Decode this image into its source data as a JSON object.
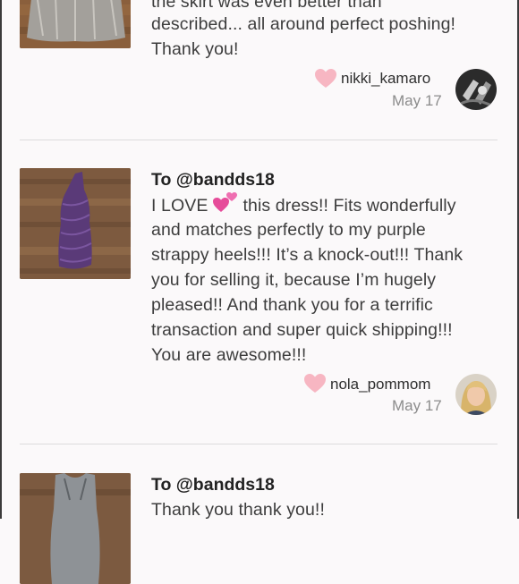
{
  "reviews": [
    {
      "to": "",
      "lines": [
        "the skirt was even better than",
        "described... all around perfect poshing!",
        "Thank you!"
      ],
      "username": "nikki_kamaro",
      "date": "May 17",
      "thumb_icon": "gray-skirt-photo",
      "avatar_icon": "nail-art-avatar"
    },
    {
      "to": "To @bandds18",
      "lines": [
        "I LOVE",
        " this dress!! Fits wonderfully",
        "and matches perfectly to my purple",
        "strappy heels!!! It’s a knock-out!!! Thank",
        "you for selling it, because I’m hugely",
        "pleased!! And thank you for a terrific",
        "transaction and super quick shipping!!!",
        "You are awesome!!!"
      ],
      "username": "nola_pommom",
      "date": "May 17",
      "thumb_icon": "purple-dress-photo",
      "avatar_icon": "blonde-woman-avatar"
    },
    {
      "to": "To @bandds18",
      "lines": [
        "Thank you thank you!!"
      ],
      "thumb_icon": "gray-dress-photo"
    }
  ],
  "colors": {
    "heart": "#f7b6c2",
    "divider": "#dcdcdc",
    "date": "#8c8c8c",
    "background": "#fbf9fa"
  }
}
